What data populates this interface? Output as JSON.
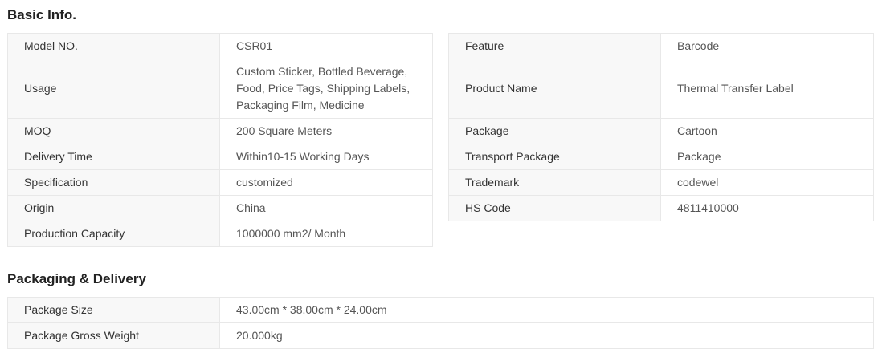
{
  "basic_info": {
    "title": "Basic Info.",
    "left_rows": [
      {
        "label": "Model NO.",
        "value": "CSR01"
      },
      {
        "label": "Usage",
        "value": "Custom Sticker, Bottled Beverage, Food, Price Tags, Shipping Labels, Packaging Film, Medicine"
      },
      {
        "label": "MOQ",
        "value": "200 Square Meters"
      },
      {
        "label": "Delivery Time",
        "value": "Within10-15 Working Days"
      },
      {
        "label": "Specification",
        "value": "customized"
      },
      {
        "label": "Origin",
        "value": "China"
      },
      {
        "label": "Production Capacity",
        "value": "1000000 mm2/ Month"
      }
    ],
    "right_rows": [
      {
        "label": "Feature",
        "value": "Barcode"
      },
      {
        "label": "Product Name",
        "value": "Thermal Transfer Label"
      },
      {
        "label": "Package",
        "value": "Cartoon"
      },
      {
        "label": "Transport Package",
        "value": "Package"
      },
      {
        "label": "Trademark",
        "value": "codewel"
      },
      {
        "label": "HS Code",
        "value": "4811410000"
      }
    ]
  },
  "packaging": {
    "title": "Packaging & Delivery",
    "rows": [
      {
        "label": "Package Size",
        "value": "43.00cm * 38.00cm * 24.00cm"
      },
      {
        "label": "Package Gross Weight",
        "value": "20.000kg"
      }
    ]
  }
}
